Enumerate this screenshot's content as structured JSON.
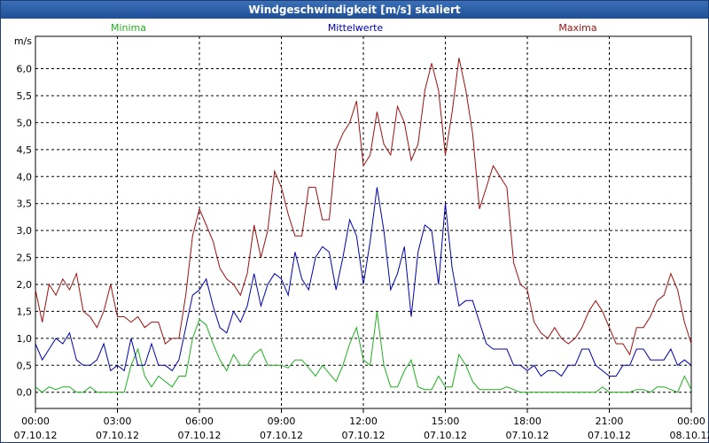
{
  "window": {
    "title": "Windgeschwindigkeit [m/s] skaliert"
  },
  "colors": {
    "min": "#20b020",
    "mean": "#0000b0",
    "max": "#a01010",
    "grid": "#000000",
    "titlebar": "#2a5ca8"
  },
  "chart_data": {
    "type": "line",
    "title": "Windgeschwindigkeit [m/s] skaliert",
    "ylabel": "m/s",
    "ylim": [
      -0.3,
      6.6
    ],
    "yticks": [
      "0,0",
      "0,5",
      "1,0",
      "1,5",
      "2,0",
      "2,5",
      "3,0",
      "3,5",
      "4,0",
      "4,5",
      "5,0",
      "5,5",
      "6,0"
    ],
    "ytick_values": [
      0,
      0.5,
      1,
      1.5,
      2,
      2.5,
      3,
      3.5,
      4,
      4.5,
      5,
      5.5,
      6
    ],
    "xticks": [
      {
        "time": "00:00",
        "date": "07.10.12"
      },
      {
        "time": "03:00",
        "date": "07.10.12"
      },
      {
        "time": "06:00",
        "date": "07.10.12"
      },
      {
        "time": "09:00",
        "date": "07.10.12"
      },
      {
        "time": "12:00",
        "date": "07.10.12"
      },
      {
        "time": "15:00",
        "date": "07.10.12"
      },
      {
        "time": "18:00",
        "date": "07.10.12"
      },
      {
        "time": "21:00",
        "date": "07.10.12"
      },
      {
        "time": "00:00",
        "date": "08.10.12"
      }
    ],
    "grid": true,
    "x_hours": [
      0,
      0.25,
      0.5,
      0.75,
      1,
      1.25,
      1.5,
      1.75,
      2,
      2.25,
      2.5,
      2.75,
      3,
      3.25,
      3.5,
      3.75,
      4,
      4.25,
      4.5,
      4.75,
      5,
      5.25,
      5.5,
      5.75,
      6,
      6.25,
      6.5,
      6.75,
      7,
      7.25,
      7.5,
      7.75,
      8,
      8.25,
      8.5,
      8.75,
      9,
      9.25,
      9.5,
      9.75,
      10,
      10.25,
      10.5,
      10.75,
      11,
      11.25,
      11.5,
      11.75,
      12,
      12.25,
      12.5,
      12.75,
      13,
      13.25,
      13.5,
      13.75,
      14,
      14.25,
      14.5,
      14.75,
      15,
      15.25,
      15.5,
      15.75,
      16,
      16.25,
      16.5,
      16.75,
      17,
      17.25,
      17.5,
      17.75,
      18,
      18.25,
      18.5,
      18.75,
      19,
      19.25,
      19.5,
      19.75,
      20,
      20.25,
      20.5,
      20.75,
      21,
      21.25,
      21.5,
      21.75,
      22,
      22.25,
      22.5,
      22.75,
      23,
      23.25,
      23.5,
      23.75,
      24
    ],
    "series": [
      {
        "name": "Minima",
        "color": "#20b020",
        "values": [
          0.1,
          0,
          0.1,
          0.05,
          0.1,
          0.1,
          0,
          0,
          0.1,
          0,
          0,
          0,
          0,
          0,
          0.5,
          0.8,
          0.3,
          0.1,
          0.3,
          0.2,
          0.1,
          0.3,
          0.3,
          1.0,
          1.35,
          1.25,
          0.9,
          0.6,
          0.4,
          0.7,
          0.5,
          0.5,
          0.7,
          0.8,
          0.5,
          0.5,
          0.5,
          0.45,
          0.6,
          0.6,
          0.45,
          0.3,
          0.5,
          0.35,
          0.2,
          0.5,
          0.9,
          1.2,
          0.6,
          0.5,
          1.5,
          0.5,
          0.1,
          0.1,
          0.4,
          0.6,
          0.1,
          0.05,
          0.05,
          0.3,
          0.1,
          0.1,
          0.7,
          0.5,
          0.2,
          0.05,
          0.05,
          0.05,
          0.05,
          0.1,
          0.05,
          0,
          0,
          0,
          0,
          0,
          0,
          0,
          0,
          0,
          0,
          0,
          0,
          0.1,
          0,
          0,
          0,
          0,
          0.05,
          0.05,
          0,
          0.1,
          0.1,
          0.05,
          0,
          0.3,
          0.05
        ]
      },
      {
        "name": "Mittelwerte",
        "color": "#0000b0",
        "values": [
          0.9,
          0.6,
          0.8,
          1.0,
          0.9,
          1.1,
          0.6,
          0.5,
          0.5,
          0.6,
          0.9,
          0.4,
          0.5,
          0.4,
          1.0,
          0.5,
          0.5,
          0.9,
          0.5,
          0.5,
          0.4,
          0.6,
          1.2,
          1.8,
          1.9,
          2.1,
          1.6,
          1.2,
          1.1,
          1.5,
          1.3,
          1.6,
          2.2,
          1.6,
          2.0,
          2.2,
          2.1,
          1.8,
          2.6,
          2.1,
          1.9,
          2.5,
          2.7,
          2.6,
          1.9,
          2.5,
          3.2,
          2.9,
          2.0,
          2.8,
          3.8,
          3.0,
          1.9,
          2.2,
          2.7,
          1.4,
          2.6,
          3.1,
          3.0,
          2.0,
          3.5,
          2.3,
          1.6,
          1.7,
          1.7,
          1.3,
          0.9,
          0.8,
          0.8,
          0.8,
          0.5,
          0.5,
          0.4,
          0.5,
          0.3,
          0.4,
          0.4,
          0.3,
          0.5,
          0.5,
          0.8,
          0.8,
          0.5,
          0.4,
          0.3,
          0.3,
          0.5,
          0.5,
          0.8,
          0.8,
          0.6,
          0.6,
          0.6,
          0.8,
          0.5,
          0.6,
          0.5
        ]
      },
      {
        "name": "Maxima",
        "color": "#a01010",
        "values": [
          1.9,
          1.3,
          2.0,
          1.8,
          2.1,
          1.9,
          2.2,
          1.5,
          1.4,
          1.2,
          1.5,
          2.0,
          1.4,
          1.4,
          1.3,
          1.4,
          1.2,
          1.3,
          1.3,
          0.9,
          1.0,
          1.0,
          1.8,
          2.9,
          3.4,
          3.1,
          2.8,
          2.3,
          2.1,
          2.0,
          1.8,
          2.2,
          3.1,
          2.5,
          3.0,
          4.1,
          3.8,
          3.3,
          2.9,
          2.9,
          3.8,
          3.8,
          3.2,
          3.2,
          4.5,
          4.8,
          5.0,
          5.4,
          4.2,
          4.4,
          5.2,
          4.6,
          4.4,
          5.3,
          5.0,
          4.3,
          4.6,
          5.6,
          6.1,
          5.6,
          4.4,
          5.2,
          6.2,
          5.6,
          4.8,
          3.4,
          3.8,
          4.2,
          4.0,
          3.8,
          2.4,
          2.0,
          1.9,
          1.3,
          1.1,
          1.0,
          1.2,
          1.0,
          0.9,
          1.0,
          1.2,
          1.5,
          1.7,
          1.5,
          1.2,
          0.9,
          0.9,
          0.7,
          1.2,
          1.2,
          1.4,
          1.7,
          1.8,
          2.2,
          1.9,
          1.3,
          0.9
        ]
      }
    ]
  }
}
